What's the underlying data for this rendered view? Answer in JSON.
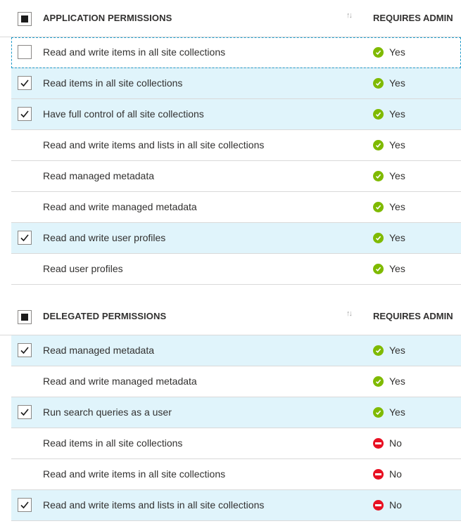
{
  "application": {
    "title": "APPLICATION PERMISSIONS",
    "admin_header": "REQUIRES ADMIN",
    "sort_icon": "sort-icon",
    "rows": [
      {
        "label": "Read and write items in all site collections",
        "checked": false,
        "show_cb": true,
        "focused": true,
        "admin": "Yes",
        "status": "ok"
      },
      {
        "label": "Read items in all site collections",
        "checked": true,
        "show_cb": true,
        "admin": "Yes",
        "status": "ok"
      },
      {
        "label": "Have full control of all site collections",
        "checked": true,
        "show_cb": true,
        "admin": "Yes",
        "status": "ok"
      },
      {
        "label": "Read and write items and lists in all site collections",
        "checked": false,
        "show_cb": false,
        "admin": "Yes",
        "status": "ok"
      },
      {
        "label": "Read managed metadata",
        "checked": false,
        "show_cb": false,
        "admin": "Yes",
        "status": "ok"
      },
      {
        "label": "Read and write managed metadata",
        "checked": false,
        "show_cb": false,
        "admin": "Yes",
        "status": "ok"
      },
      {
        "label": "Read and write user profiles",
        "checked": true,
        "show_cb": true,
        "admin": "Yes",
        "status": "ok"
      },
      {
        "label": "Read user profiles",
        "checked": false,
        "show_cb": false,
        "admin": "Yes",
        "status": "ok"
      }
    ]
  },
  "delegated": {
    "title": "DELEGATED PERMISSIONS",
    "admin_header": "REQUIRES ADMIN",
    "sort_icon": "sort-icon",
    "rows": [
      {
        "label": "Read managed metadata",
        "checked": true,
        "show_cb": true,
        "admin": "Yes",
        "status": "ok"
      },
      {
        "label": "Read and write managed metadata",
        "checked": false,
        "show_cb": false,
        "admin": "Yes",
        "status": "ok"
      },
      {
        "label": "Run search queries as a user",
        "checked": true,
        "show_cb": true,
        "admin": "Yes",
        "status": "ok"
      },
      {
        "label": "Read items in all site collections",
        "checked": false,
        "show_cb": false,
        "admin": "No",
        "status": "no"
      },
      {
        "label": "Read and write items in all site collections",
        "checked": false,
        "show_cb": false,
        "admin": "No",
        "status": "no"
      },
      {
        "label": "Read and write items and lists in all site collections",
        "checked": true,
        "show_cb": true,
        "admin": "No",
        "status": "no"
      }
    ]
  },
  "colors": {
    "selected_row": "#e0f4fb",
    "ok": "#7fba00",
    "no": "#e81123",
    "focus": "#1e9aca"
  }
}
